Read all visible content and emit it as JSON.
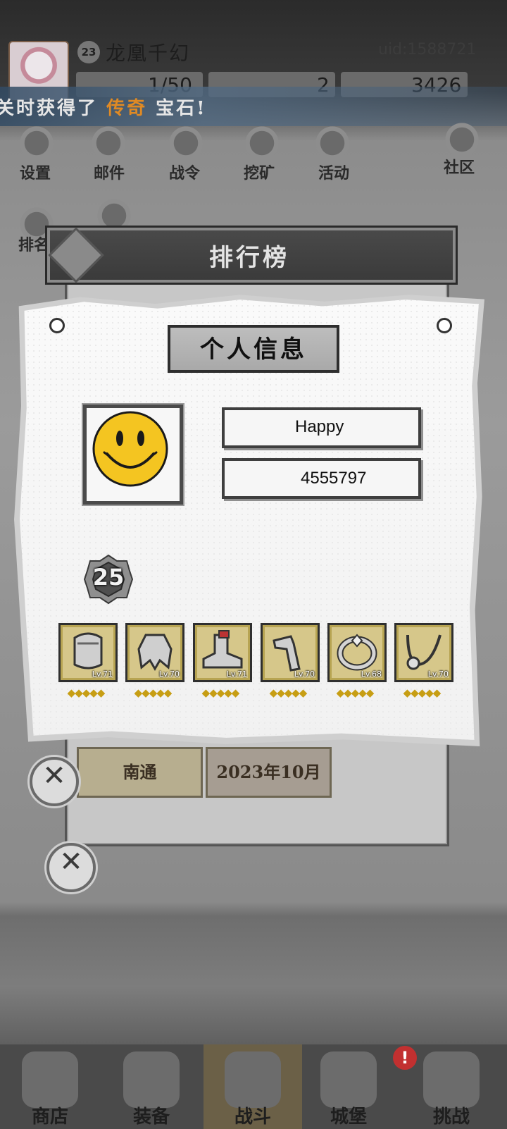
{
  "top_bar": {
    "level": "23",
    "player_name": "龙凰千幻",
    "uid": "uid:1588721",
    "resource_1": "1/50",
    "resource_2": "2",
    "resource_3": "3426"
  },
  "ticker": {
    "prefix": "关时获得了",
    "highlight": "传奇",
    "suffix": "宝石!"
  },
  "menu": {
    "settings": "设置",
    "mail": "邮件",
    "battle_pass": "战令",
    "mining": "挖矿",
    "events": "活动",
    "community": "社区",
    "ranking": "排名"
  },
  "leaderboard": {
    "title": "排行榜",
    "location": "南通",
    "date": "2023年10月"
  },
  "profile": {
    "title": "个人信息",
    "name": "Happy",
    "id": "4555797",
    "level": "25",
    "equipment": [
      {
        "item": "helmet",
        "level": "Lv.71",
        "stars": "◆◆◆◆◆"
      },
      {
        "item": "cape",
        "level": "Lv.70",
        "stars": "◆◆◆◆◆"
      },
      {
        "item": "boots",
        "level": "Lv.71",
        "stars": "◆◆◆◆◆"
      },
      {
        "item": "gauntlet",
        "level": "Lv.70",
        "stars": "◆◆◆◆◆"
      },
      {
        "item": "ring",
        "level": "Lv.68",
        "stars": "◆◆◆◆◆"
      },
      {
        "item": "necklace",
        "level": "Lv.70",
        "stars": "◆◆◆◆◆"
      }
    ]
  },
  "bottom_nav": {
    "shop": "商店",
    "equipment": "装备",
    "battle": "战斗",
    "castle": "城堡",
    "challenge": "挑战",
    "notification": "!"
  }
}
